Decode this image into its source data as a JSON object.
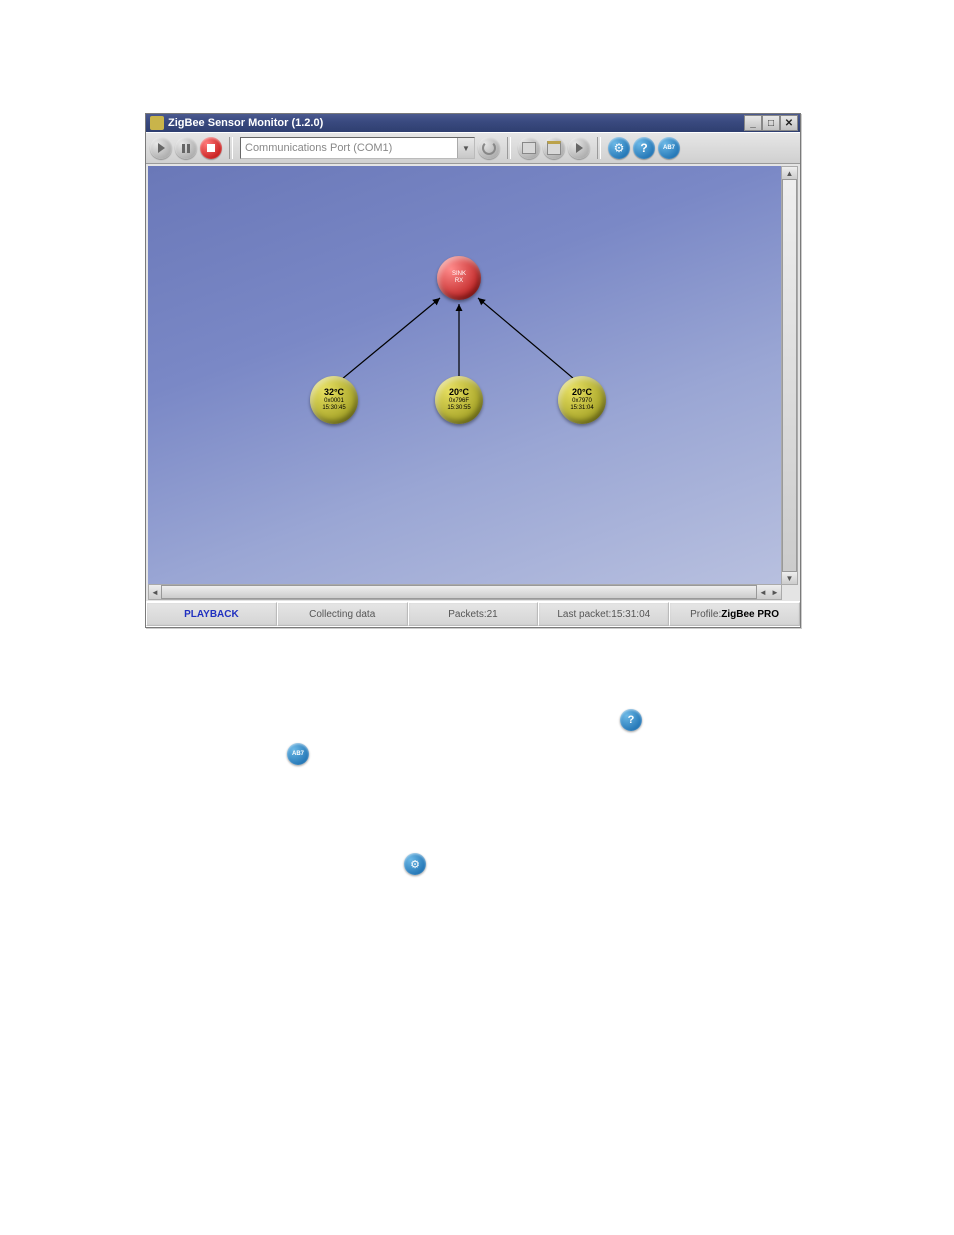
{
  "window": {
    "title": "ZigBee Sensor Monitor (1.2.0)",
    "controls": {
      "min": "_",
      "max": "□",
      "close": "✕"
    }
  },
  "toolbar": {
    "combo_value": "Communications Port (COM1)",
    "ab_label": "AB7"
  },
  "network": {
    "sink": {
      "label1": "SINK",
      "label2": "RX"
    },
    "nodes": [
      {
        "temp": "32°C",
        "addr": "0x0001",
        "time": "15:30:45"
      },
      {
        "temp": "20°C",
        "addr": "0x796F",
        "time": "15:30:55"
      },
      {
        "temp": "20°C",
        "addr": "0x7970",
        "time": "15:31:04"
      }
    ]
  },
  "status": {
    "mode": "PLAYBACK",
    "state": "Collecting data",
    "packets_label": "Packets: ",
    "packets_value": "21",
    "lastpacket_label": "Last packet: ",
    "lastpacket_value": "15:31:04",
    "profile_label": "Profile: ",
    "profile_value": "ZigBee PRO"
  },
  "floating": {
    "ab": "AB7",
    "help": "?",
    "gear": "⚙"
  }
}
